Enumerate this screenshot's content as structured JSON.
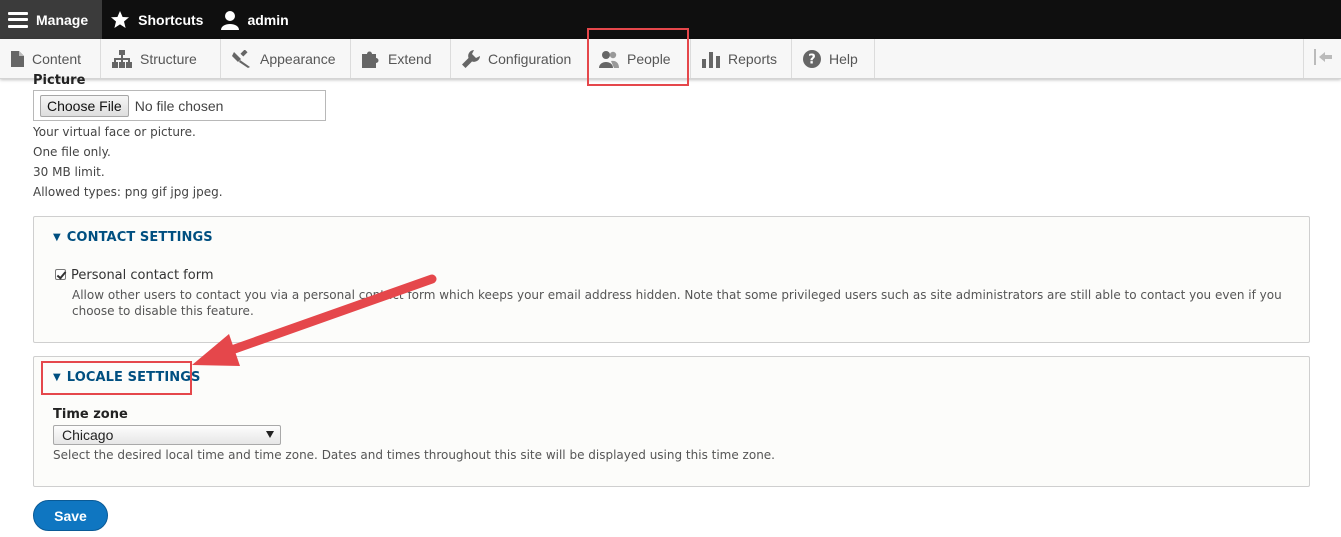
{
  "toolbar": {
    "manage": "Manage",
    "shortcuts": "Shortcuts",
    "user": "admin"
  },
  "tray": {
    "items": [
      {
        "label": "Content",
        "icon": "page-icon"
      },
      {
        "label": "Structure",
        "icon": "structure-icon"
      },
      {
        "label": "Appearance",
        "icon": "appearance-icon"
      },
      {
        "label": "Extend",
        "icon": "puzzle-icon"
      },
      {
        "label": "Configuration",
        "icon": "wrench-icon"
      },
      {
        "label": "People",
        "icon": "people-icon"
      },
      {
        "label": "Reports",
        "icon": "bar-chart-icon"
      },
      {
        "label": "Help",
        "icon": "help-icon"
      }
    ],
    "highlighted": "People"
  },
  "picture": {
    "label": "Picture",
    "choose_button": "Choose File",
    "status": "No file chosen",
    "descriptions": [
      "Your virtual face or picture.",
      "One file only.",
      "30 MB limit.",
      "Allowed types: png gif jpg jpeg."
    ]
  },
  "contact": {
    "legend": "CONTACT SETTINGS",
    "checkbox_label": "Personal contact form",
    "checked": true,
    "description_line1": "Allow other users to contact you via a personal contact form which keeps your email address hidden. Note that some privileged users such as site administrators are still able to contact you even if you",
    "description_line2": "choose to disable this feature."
  },
  "locale": {
    "legend": "LOCALE SETTINGS",
    "timezone_label": "Time zone",
    "timezone_value": "Chicago",
    "description": "Select the desired local time and time zone. Dates and times throughout this site will be displayed using this time zone."
  },
  "actions": {
    "save": "Save"
  },
  "colors": {
    "annotation": "#e5474b",
    "link": "#004f80",
    "primary_button": "#0f76c1"
  }
}
